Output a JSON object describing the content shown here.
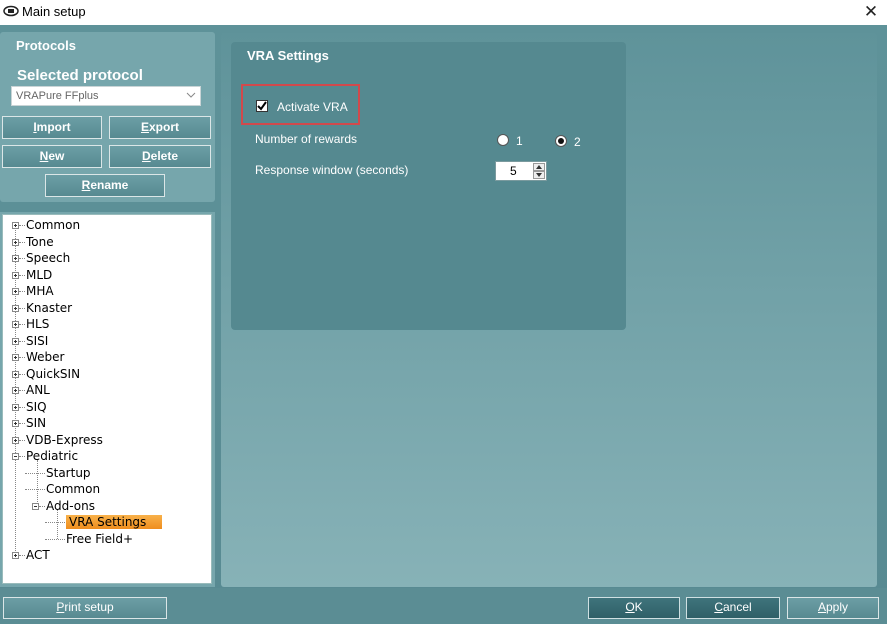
{
  "window": {
    "title": "Main setup",
    "close_glyph": "✕"
  },
  "left": {
    "protocols_title": "Protocols",
    "selected_protocol_title": "Selected protocol",
    "selected_protocol_value": "VRAPure FFplus",
    "buttons": {
      "import": {
        "mnemonic": "I",
        "rest": "mport"
      },
      "export": {
        "mnemonic": "E",
        "rest": "xport"
      },
      "new": {
        "mnemonic": "N",
        "rest": "ew"
      },
      "delete": {
        "mnemonic": "D",
        "rest": "elete"
      },
      "rename": {
        "mnemonic": "R",
        "rest": "ename"
      }
    }
  },
  "tree": {
    "nodes": [
      {
        "label": "Common",
        "expander": "plus"
      },
      {
        "label": "Tone",
        "expander": "plus"
      },
      {
        "label": "Speech",
        "expander": "plus"
      },
      {
        "label": "MLD",
        "expander": "plus"
      },
      {
        "label": "MHA",
        "expander": "plus"
      },
      {
        "label": "Knaster",
        "expander": "plus"
      },
      {
        "label": "HLS",
        "expander": "plus"
      },
      {
        "label": "SISI",
        "expander": "plus"
      },
      {
        "label": "Weber",
        "expander": "plus"
      },
      {
        "label": "QuickSIN",
        "expander": "plus"
      },
      {
        "label": "ANL",
        "expander": "plus"
      },
      {
        "label": "SIQ",
        "expander": "plus"
      },
      {
        "label": "SIN",
        "expander": "plus"
      },
      {
        "label": "VDB-Express",
        "expander": "plus"
      },
      {
        "label": "Pediatric",
        "expander": "minus"
      },
      {
        "label": "Startup",
        "expander": "none"
      },
      {
        "label": "Common",
        "expander": "none"
      },
      {
        "label": "Add-ons",
        "expander": "minus"
      },
      {
        "label": "VRA Settings",
        "expander": "none",
        "selected": true
      },
      {
        "label": "Free Field+",
        "expander": "none"
      },
      {
        "label": "ACT",
        "expander": "plus"
      }
    ]
  },
  "vra": {
    "title": "VRA Settings",
    "activate_label": "Activate VRA",
    "activate_checked": true,
    "rewards_label": "Number of rewards",
    "reward_options": [
      "1",
      "2"
    ],
    "reward_selected": "2",
    "response_window_label": "Response window (seconds)",
    "response_window_value": "5"
  },
  "bottom": {
    "print_setup": {
      "mnemonic": "P",
      "rest": "rint setup"
    },
    "ok": {
      "mnemonic": "O",
      "rest": "K"
    },
    "cancel": {
      "mnemonic": "C",
      "rest": "ancel"
    },
    "apply": {
      "mnemonic": "A",
      "rest": "pply"
    }
  },
  "colors": {
    "accent_highlight": "#ef8d1d",
    "panel": "#558990",
    "focus_outline": "#d2494c"
  }
}
